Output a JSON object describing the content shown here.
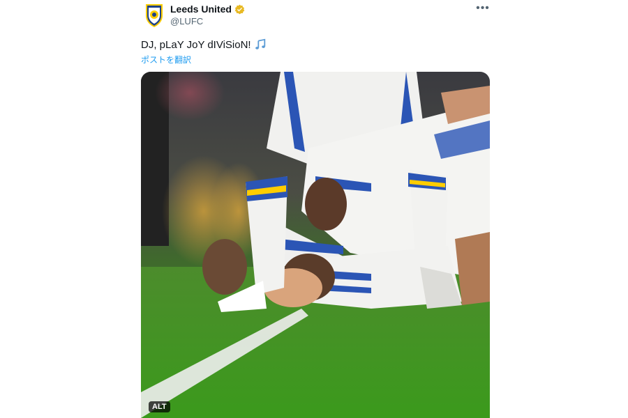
{
  "account": {
    "display_name": "Leeds United",
    "handle": "@LUFC",
    "verified_color": "#e8b923"
  },
  "tweet": {
    "text": "DJ, pLaY JoY dIViSioN!",
    "emoji_icon": "musical-notes-icon",
    "translate_label": "ポストを翻訳"
  },
  "media": {
    "alt_label": "ALT"
  },
  "colors": {
    "link": "#1d9bf0",
    "muted": "#536471",
    "leeds_blue": "#1d428a",
    "leeds_yellow": "#ffcd00"
  }
}
